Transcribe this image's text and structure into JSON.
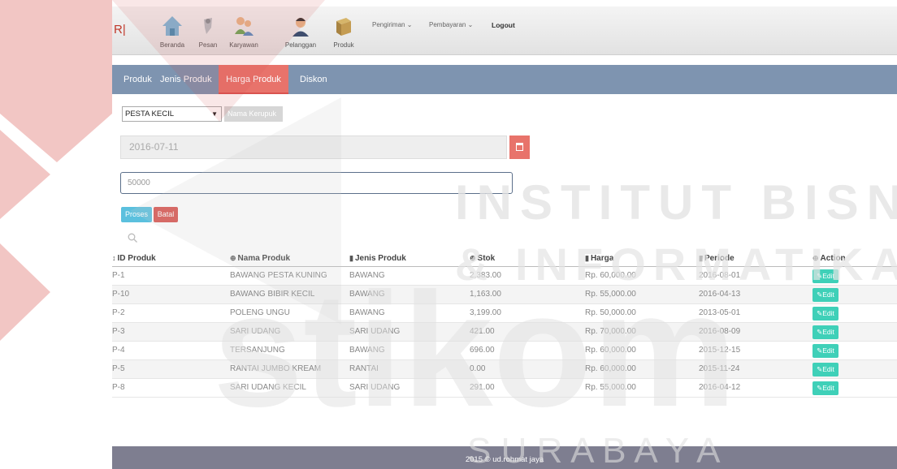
{
  "brand": "R|",
  "nav": {
    "items": [
      {
        "label": "Beranda",
        "icon": "home-icon"
      },
      {
        "label": "Pesan",
        "icon": "message-icon"
      },
      {
        "label": "Karyawan",
        "icon": "users-icon"
      },
      {
        "label": "Pelanggan",
        "icon": "customer-icon"
      },
      {
        "label": "Produk",
        "icon": "product-icon"
      }
    ],
    "dropdowns": [
      "Pengiriman ⌄",
      "Pembayaran ⌄"
    ],
    "logout": "Logout"
  },
  "tabs": [
    {
      "label": "Produk",
      "active": false
    },
    {
      "label": "Jenis Produk",
      "active": false
    },
    {
      "label": "Harga Produk",
      "active": true
    },
    {
      "label": "Diskon",
      "active": false
    }
  ],
  "form": {
    "select_value": "PESTA KECIL",
    "name_placeholder": "Nama Kerupuk",
    "date_value": "2016-07-11",
    "price_value": "50000",
    "proses_label": "Proses",
    "batal_label": "Batal"
  },
  "table": {
    "headers": [
      {
        "icon": "↕",
        "label": "ID Produk"
      },
      {
        "icon": "⊕",
        "label": "Nama Produk"
      },
      {
        "icon": "▮",
        "label": "Jenis Produk"
      },
      {
        "icon": "⊕",
        "label": "Stok"
      },
      {
        "icon": "▮",
        "label": "Harga"
      },
      {
        "icon": "▮",
        "label": "Periode"
      },
      {
        "icon": "⊕",
        "label": "Action"
      }
    ],
    "rows": [
      [
        "P-1",
        "BAWANG PESTA KUNING",
        "BAWANG",
        "2,383.00",
        "Rp. 60,000.00",
        "2016-08-01",
        "Edit"
      ],
      [
        "P-10",
        "BAWANG BIBIR KECIL",
        "BAWANG",
        "1,163.00",
        "Rp. 55,000.00",
        "2016-04-13",
        "Edit"
      ],
      [
        "P-2",
        "POLENG UNGU",
        "BAWANG",
        "3,199.00",
        "Rp. 50,000.00",
        "2013-05-01",
        "Edit"
      ],
      [
        "P-3",
        "SARI UDANG",
        "SARI UDANG",
        "421.00",
        "Rp. 70,000.00",
        "2016-08-09",
        "Edit"
      ],
      [
        "P-4",
        "TERSANJUNG",
        "BAWANG",
        "696.00",
        "Rp. 60,000.00",
        "2015-12-15",
        "Edit"
      ],
      [
        "P-5",
        "RANTAI JUMBO KREAM",
        "RANTAI",
        "0.00",
        "Rp. 60,000.00",
        "2015-11-24",
        "Edit"
      ],
      [
        "P-8",
        "SARI UDANG KECIL",
        "SARI UDANG",
        "291.00",
        "Rp. 55,000.00",
        "2016-04-12",
        "Edit"
      ]
    ]
  },
  "footer": "2015 © ud.rohmat jaya",
  "watermark": {
    "line1": "INSTITUT BISNIS",
    "line2": "& INFORMATIKA",
    "line3": "stikom",
    "line4": "S U R A B A Y A",
    "color": "#e8e8e8",
    "logo_color": "#d9534f"
  }
}
